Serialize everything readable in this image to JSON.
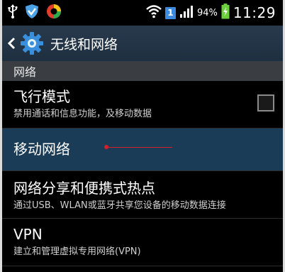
{
  "status_bar": {
    "battery_percent": "94%",
    "time": "11:29",
    "sim_label": "1",
    "icons": [
      "usb-icon",
      "shield-icon",
      "app-circle-icon",
      "wifi-icon",
      "sim-icon",
      "signal-icon",
      "battery-charging-icon"
    ]
  },
  "action_bar": {
    "title": "无线和网络",
    "back_icon": "chevron-left-icon",
    "app_icon": "gear-icon"
  },
  "section": {
    "header": "网络"
  },
  "items": [
    {
      "title": "飞行模式",
      "subtitle": "禁用通话和信息功能，及移动数据",
      "checked": false
    },
    {
      "title": "移动网络",
      "subtitle": ""
    },
    {
      "title": "网络分享和便携式热点",
      "subtitle": "通过USB、WLAN或蓝牙共享您设备的移动数据连接"
    },
    {
      "title": "VPN",
      "subtitle": "建立和管理虚拟专用网络(VPN)"
    }
  ],
  "colors": {
    "action_bar": "#1e2f40",
    "section_header": "#3a3d42",
    "highlight": "#1b3c57",
    "annotation_red": "#d51f2a"
  }
}
